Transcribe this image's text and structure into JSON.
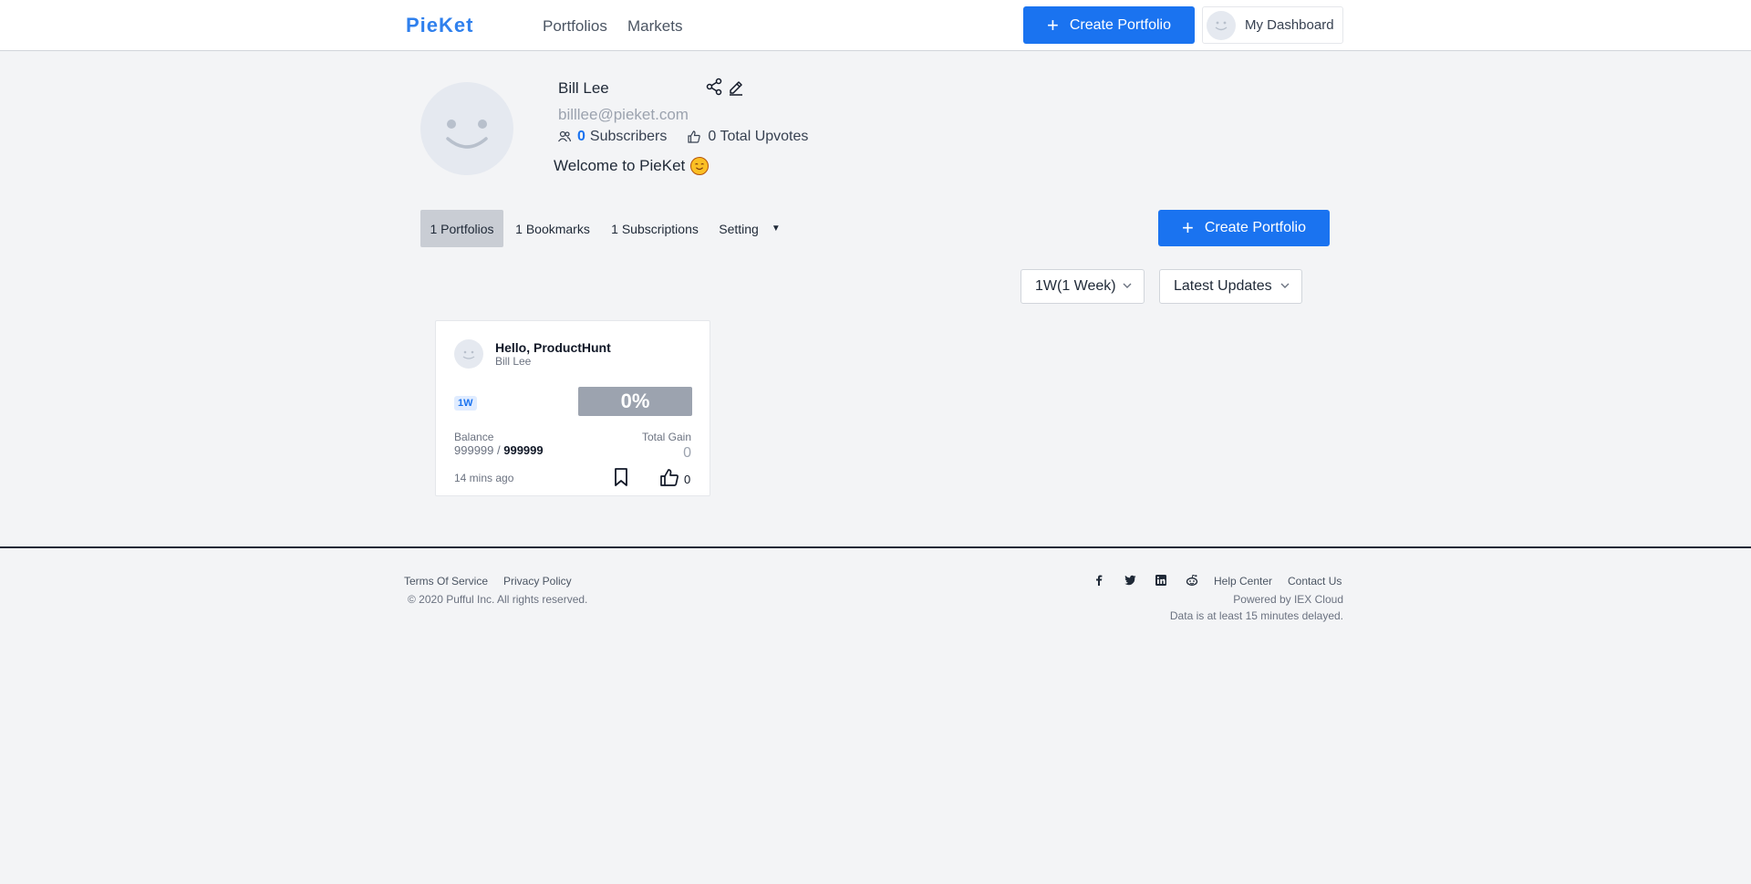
{
  "header": {
    "logo": "PieKet",
    "nav": [
      "Portfolios",
      "Markets"
    ],
    "create_label": "Create Portfolio",
    "dashboard_label": "My Dashboard"
  },
  "profile": {
    "name": "Bill Lee",
    "email": "billlee@pieket.com",
    "subscribers_count": "0",
    "subscribers_label": "Subscribers",
    "upvotes_text": "0 Total Upvotes",
    "welcome": "Welcome to PieKet"
  },
  "tabs": {
    "portfolios": "1 Portfolios",
    "bookmarks": "1 Bookmarks",
    "subscriptions": "1 Subscriptions",
    "setting": "Setting",
    "create_label": "Create Portfolio"
  },
  "filters": {
    "period": "1W(1 Week)",
    "sort": "Latest Updates"
  },
  "card": {
    "title": "Hello, ProductHunt",
    "author": "Bill Lee",
    "badge": "1W",
    "percent": "0%",
    "balance_label": "Balance",
    "balance_current": "999999",
    "balance_sep": " / ",
    "balance_total": "999999",
    "gain_label": "Total Gain",
    "gain_value": "0",
    "time": "14 mins ago",
    "likes": "0"
  },
  "footer": {
    "terms": "Terms Of Service",
    "privacy": "Privacy Policy",
    "copyright": "© 2020 Pufful Inc. All rights reserved.",
    "help": "Help Center",
    "contact": "Contact Us",
    "powered": "Powered by IEX Cloud",
    "delay": "Data is at least 15 minutes delayed.",
    "social_icons": [
      "facebook-icon",
      "twitter-icon",
      "linkedin-icon",
      "reddit-icon"
    ]
  },
  "colors": {
    "primary": "#1a73f0",
    "background": "#f3f4f6",
    "percent_badge": "#9ca3af"
  }
}
